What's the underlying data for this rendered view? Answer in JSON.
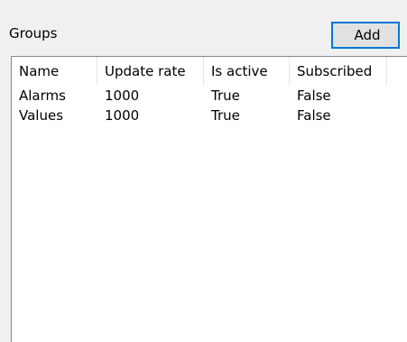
{
  "groups_panel": {
    "title": "Groups",
    "add_label": "Add"
  },
  "list": {
    "columns": [
      "Name",
      "Update rate",
      "Is active",
      "Subscribed"
    ],
    "rows": [
      [
        "Alarms",
        "1000",
        "True",
        "False"
      ],
      [
        "Values",
        "1000",
        "True",
        "False"
      ]
    ]
  },
  "colors": {
    "window_bg": "#f0f0f0",
    "list_bg": "#ffffff",
    "button_focus_border": "#0078d7",
    "list_border": "#828790"
  }
}
